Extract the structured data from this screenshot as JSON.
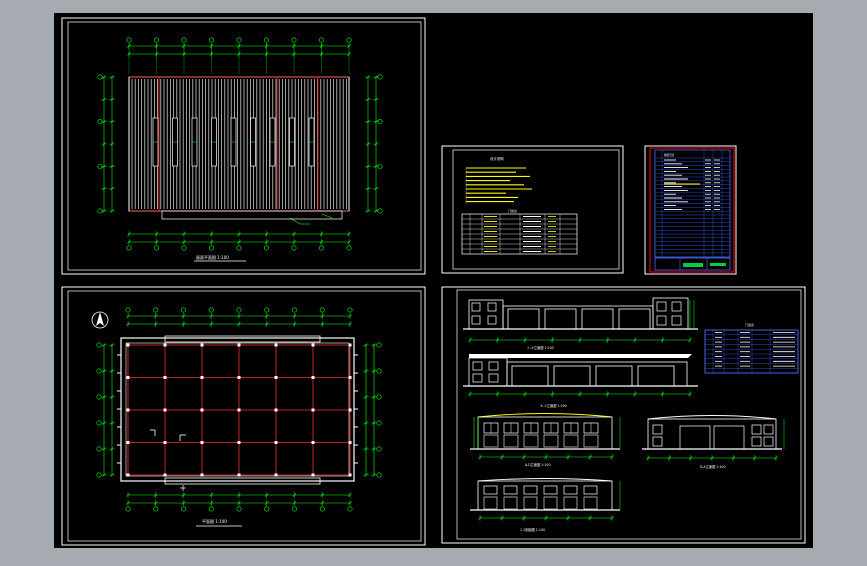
{
  "colors": {
    "viewport_bg": "#a5abb1",
    "canvas_bg": "#000000",
    "frame": "#ffffff",
    "grid_red": "#ff2a2a",
    "dim_green": "#00ff00",
    "outline_white": "#ffffff",
    "table_blue": "#3f5cff",
    "text_yellow": "#ffff00",
    "label_cyan": "#00e5ff",
    "titleblock_red": "#ff0000"
  },
  "sheets": {
    "roof_plan": {
      "title": "屋面平面图 1:100"
    },
    "floor_plan": {
      "title": "平面图 1:100",
      "north_symbol": "north-arrow-icon"
    },
    "design_notes": {
      "title": "设计说明",
      "table_title": "门窗表"
    },
    "drawing_index": {
      "title": "图纸目录"
    },
    "elevations": {
      "elevation_a": "①-⑨立面图 1:100",
      "elevation_b": "⑨-①立面图 1:100",
      "elevation_c": "A-D立面图 1:100",
      "elevation_d": "D-A立面图 1:100",
      "section": "1-1剖面图 1:100",
      "door_table_title": "门窗表"
    }
  }
}
